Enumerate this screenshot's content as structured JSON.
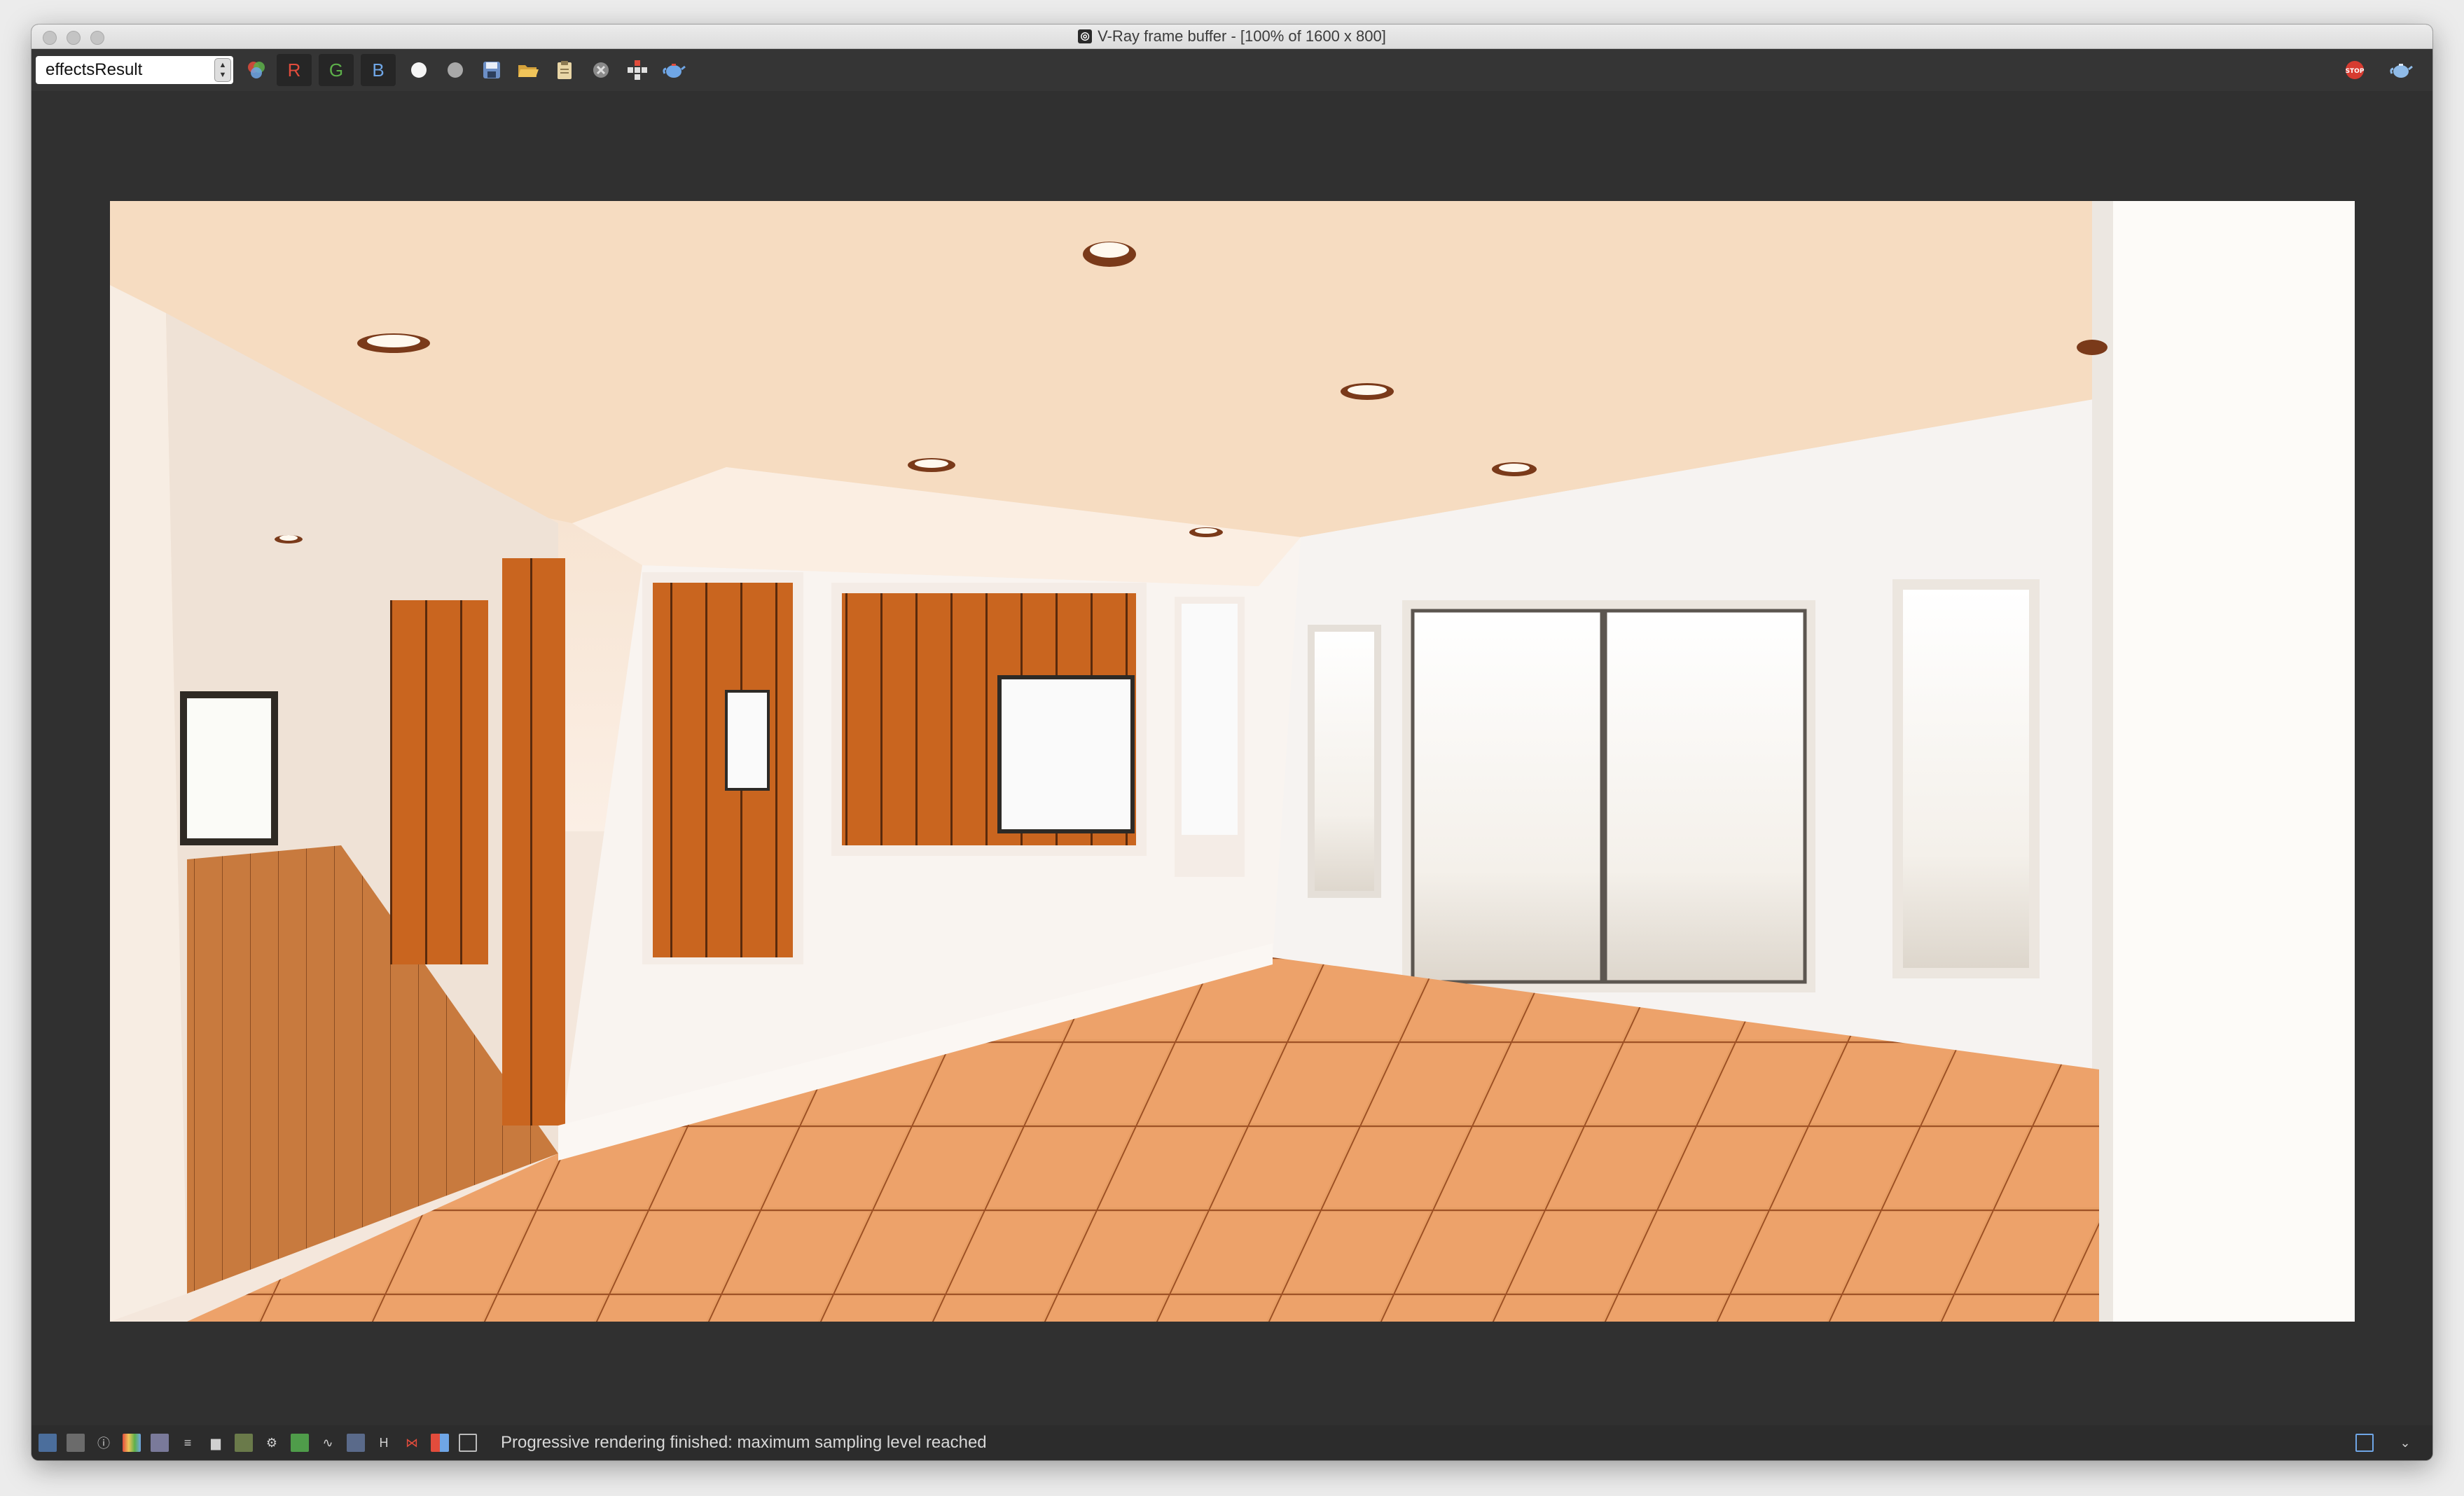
{
  "window": {
    "title": "V-Ray frame buffer - [100% of 1600 x 800]",
    "app_icon": "vray-logo-icon"
  },
  "toolbar": {
    "channel_value": "effectsResult",
    "r_label": "R",
    "g_label": "G",
    "b_label": "B",
    "colors": {
      "r": "#e24c3c",
      "g": "#5db04a",
      "b": "#6fa6e6"
    },
    "icons": [
      "color-corrections-icon",
      "white-dot-icon",
      "gray-dot-icon",
      "save-icon",
      "open-icon",
      "clipboard-icon",
      "clear-icon",
      "region-render-icon",
      "teapot-render-icon"
    ],
    "right_icons": [
      "stop-render-icon",
      "render-teapot-icon"
    ]
  },
  "status": {
    "message": "Progressive rendering finished: maximum sampling level reached",
    "letter_h": "H"
  },
  "statusbar_icons": [
    "history-icon",
    "layers-icon",
    "info-icon",
    "color-lut-icon",
    "compare-icon",
    "stats-icon",
    "histogram-icon",
    "lens-icon",
    "settings-wheel-icon",
    "fit-icon",
    "curve-icon",
    "denoise-icon",
    "h-icon",
    "split-icon",
    "bars-icon",
    "track-icon"
  ]
}
